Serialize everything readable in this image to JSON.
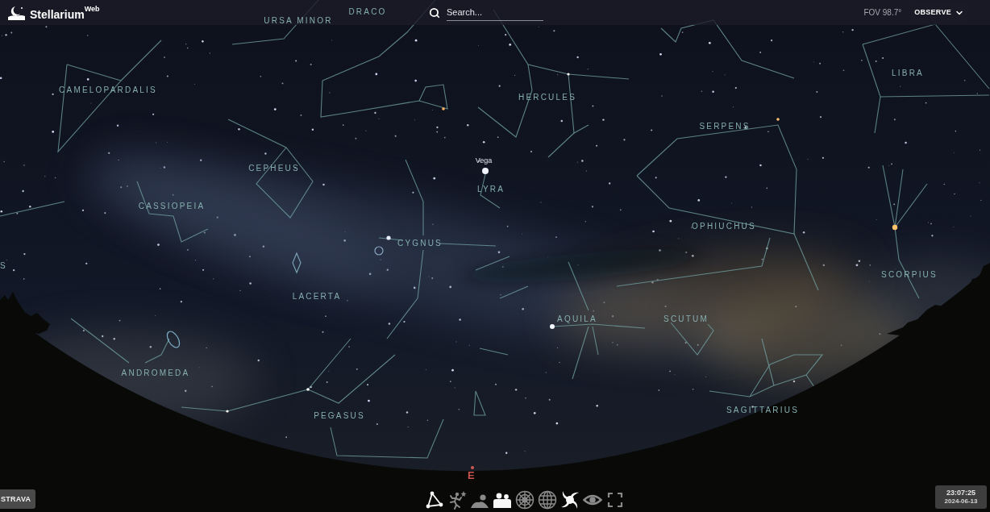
{
  "header": {
    "logo": {
      "name": "Stellarium",
      "suffix": "Web"
    },
    "search": {
      "placeholder": "Search..."
    },
    "fov": "FOV 98.7°",
    "mode_menu": {
      "label": "OBSERVE"
    }
  },
  "sky": {
    "constellations": [
      {
        "name": "DRACO"
      },
      {
        "name": "URSA MINOR"
      },
      {
        "name": "LIBRA"
      },
      {
        "name": "CAMELOPARDALIS"
      },
      {
        "name": "HERCULES"
      },
      {
        "name": "SERPENS"
      },
      {
        "name": "CEPHEUS"
      },
      {
        "name": "LYRA"
      },
      {
        "name": "CASSIOPEIA"
      },
      {
        "name": "OPHIUCHUS"
      },
      {
        "name": "CYGNUS"
      },
      {
        "name": "S"
      },
      {
        "name": "SCORPIUS"
      },
      {
        "name": "LACERTA"
      },
      {
        "name": "AQUILA"
      },
      {
        "name": "SCUTUM"
      },
      {
        "name": "ANDROMEDA"
      },
      {
        "name": "SAGITTARIUS"
      },
      {
        "name": "PEGASUS"
      }
    ],
    "stars": [
      {
        "name": "Vega"
      }
    ],
    "cardinal_point": "E"
  },
  "location_button": {
    "label": "STRAVA"
  },
  "toolbar": [
    {
      "kind": "constellation-lines",
      "on": true
    },
    {
      "kind": "constellation-art",
      "on": false
    },
    {
      "kind": "atmosphere",
      "on": false
    },
    {
      "kind": "landscape",
      "on": true
    },
    {
      "kind": "azimuthal-grid",
      "on": false
    },
    {
      "kind": "equatorial-grid",
      "on": false
    },
    {
      "kind": "deep-sky",
      "on": true
    },
    {
      "kind": "night-mode",
      "on": false
    },
    {
      "kind": "fullscreen",
      "on": false
    }
  ],
  "clock": {
    "time": "23:07:25",
    "date": "2024-06-13"
  }
}
